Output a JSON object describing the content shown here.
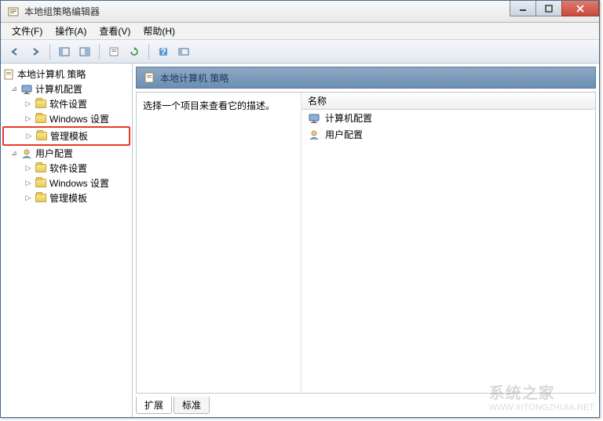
{
  "window": {
    "title": "本地组策略编辑器"
  },
  "menu": {
    "file": "文件(F)",
    "action": "操作(A)",
    "view": "查看(V)",
    "help": "帮助(H)"
  },
  "tree": {
    "root": "本地计算机 策略",
    "computer_config": "计算机配置",
    "software_settings": "软件设置",
    "windows_settings": "Windows 设置",
    "admin_templates": "管理模板",
    "user_config": "用户配置"
  },
  "right": {
    "header": "本地计算机 策略",
    "description": "选择一个项目来查看它的描述。",
    "column_name": "名称",
    "items": {
      "computer_config": "计算机配置",
      "user_config": "用户配置"
    }
  },
  "tabs": {
    "extended": "扩展",
    "standard": "标准"
  },
  "watermark": {
    "main": "系统之家",
    "sub": "WWW.XITONGZHIJIA.NET"
  }
}
